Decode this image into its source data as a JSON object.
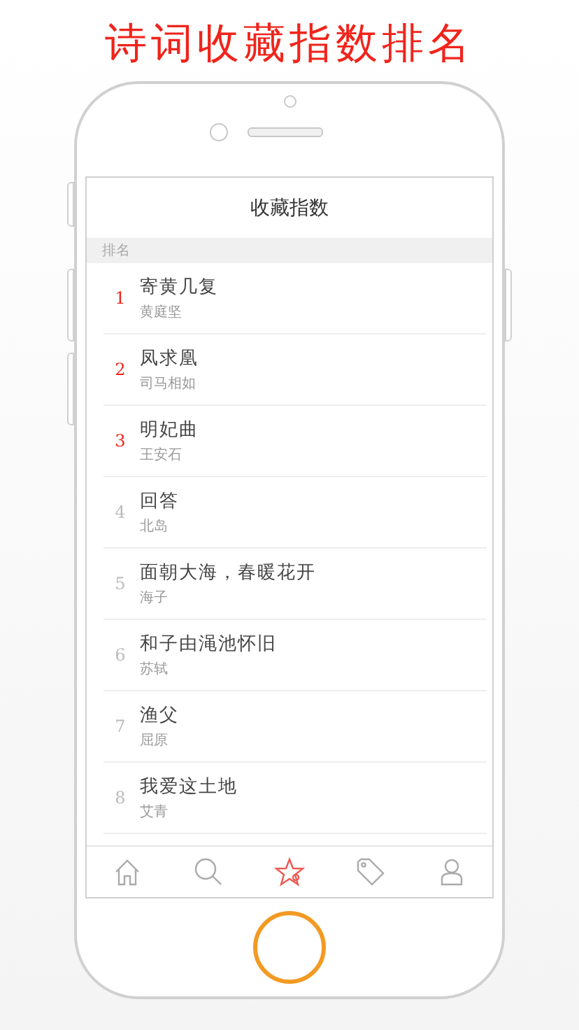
{
  "headline": "诗词收藏指数排名",
  "screen": {
    "title": "收藏指数",
    "section": "排名",
    "rows": [
      {
        "rank": "1",
        "title": "寄黄几复",
        "author": "黄庭坚",
        "top": true
      },
      {
        "rank": "2",
        "title": "凤求凰",
        "author": "司马相如",
        "top": true
      },
      {
        "rank": "3",
        "title": "明妃曲",
        "author": "王安石",
        "top": true
      },
      {
        "rank": "4",
        "title": "回答",
        "author": "北岛",
        "top": false
      },
      {
        "rank": "5",
        "title": "面朝大海，春暖花开",
        "author": "海子",
        "top": false
      },
      {
        "rank": "6",
        "title": "和子由渑池怀旧",
        "author": "苏轼",
        "top": false
      },
      {
        "rank": "7",
        "title": "渔父",
        "author": "屈原",
        "top": false
      },
      {
        "rank": "8",
        "title": "我爱这土地",
        "author": "艾青",
        "top": false
      }
    ],
    "tabs": [
      {
        "kind": "home",
        "selected": false
      },
      {
        "kind": "search",
        "selected": false
      },
      {
        "kind": "favorites",
        "selected": true
      },
      {
        "kind": "tags",
        "selected": false
      },
      {
        "kind": "profile",
        "selected": false
      }
    ]
  }
}
